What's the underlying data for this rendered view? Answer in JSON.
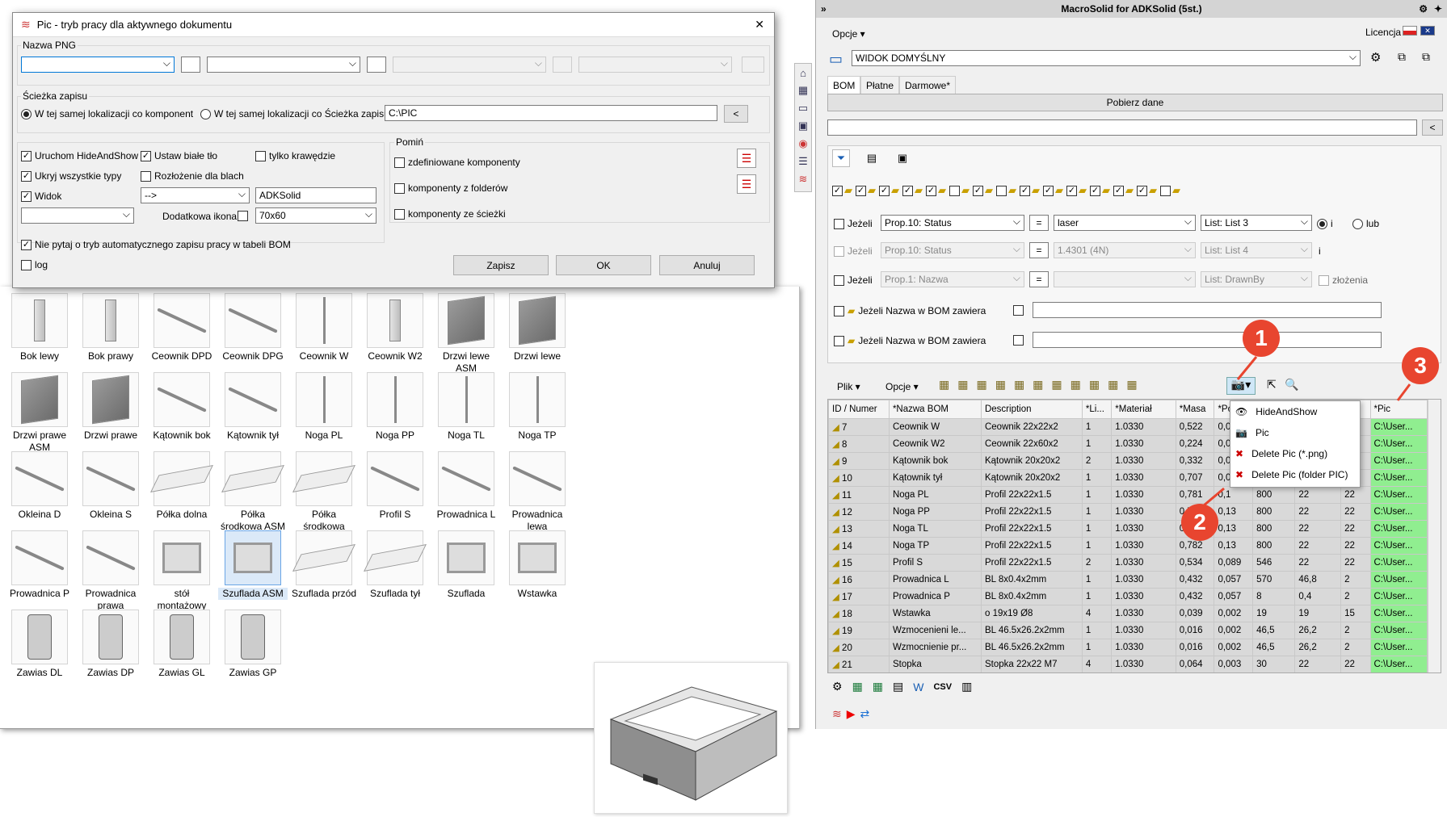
{
  "dialog": {
    "title": "Pic - tryb pracy dla aktywnego dokumentu",
    "close": "✕",
    "png_legend": "Nazwa PNG",
    "path_legend": "Ścieżka zapisu",
    "radio_component": "W tej samej lokalizacji co komponent",
    "radio_path": "W tej samej lokalizacji co Ścieżka zapisu",
    "path_value": "C:\\PIC",
    "path_btn": "<",
    "opt_hideandshow": "Uruchom HideAndShow",
    "opt_white_bg": "Ustaw białe tło",
    "opt_edges": "tylko krawędzie",
    "opt_hide_types": "Ukryj wszystkie typy",
    "opt_layout": "Rozłożenie dla blach",
    "opt_view": "Widok",
    "view_select": "-->",
    "view_name": "ADKSolid",
    "extra_icon_label": "Dodatkowa ikona",
    "extra_icon_size": "70x60",
    "skip_legend": "Pomiń",
    "skip_defined": "zdefiniowane komponenty",
    "skip_folders": "komponenty z folderów",
    "skip_paths": "komponenty ze ścieżki",
    "opt_noask": "Nie pytaj o tryb automatycznego zapisu pracy w tabeli BOM",
    "opt_log": "log",
    "btn_save": "Zapisz",
    "btn_ok": "OK",
    "btn_cancel": "Anuluj"
  },
  "explorer": {
    "items": [
      {
        "label": "Bok lewy",
        "icon": "panel"
      },
      {
        "label": "Bok prawy",
        "icon": "panel"
      },
      {
        "label": "Ceownik DPD",
        "icon": "rod"
      },
      {
        "label": "Ceownik DPG",
        "icon": "rod"
      },
      {
        "label": "Ceownik W",
        "icon": "vrod"
      },
      {
        "label": "Ceownik W2",
        "icon": "panel"
      },
      {
        "label": "Drzwi lewe ASM",
        "icon": "dark"
      },
      {
        "label": "Drzwi lewe",
        "icon": "dark"
      },
      {
        "label": "Drzwi prawe ASM",
        "icon": "dark"
      },
      {
        "label": "Drzwi prawe",
        "icon": "dark"
      },
      {
        "label": "Kątownik bok",
        "icon": "rod"
      },
      {
        "label": "Kątownik tył",
        "icon": "rod"
      },
      {
        "label": "Noga PL",
        "icon": "vrod"
      },
      {
        "label": "Noga PP",
        "icon": "vrod"
      },
      {
        "label": "Noga TL",
        "icon": "vrod"
      },
      {
        "label": "Noga TP",
        "icon": "vrod"
      },
      {
        "label": "Okleina D",
        "icon": "rod"
      },
      {
        "label": "Okleina S",
        "icon": "rod"
      },
      {
        "label": "Półka dolna",
        "icon": "plate"
      },
      {
        "label": "Półka środkowa ASM",
        "icon": "plate"
      },
      {
        "label": "Półka środkowa",
        "icon": "plate"
      },
      {
        "label": "Profil S",
        "icon": "rod"
      },
      {
        "label": "Prowadnica L",
        "icon": "rod"
      },
      {
        "label": "Prowadnica lewa",
        "icon": "rod"
      },
      {
        "label": "Prowadnica P",
        "icon": "rod"
      },
      {
        "label": "Prowadnica prawa",
        "icon": "rod"
      },
      {
        "label": "stół montażowy",
        "icon": "box"
      },
      {
        "label": "Szuflada ASM",
        "icon": "box",
        "selected": true
      },
      {
        "label": "Szuflada przód",
        "icon": "plate"
      },
      {
        "label": "Szuflada tył",
        "icon": "plate"
      },
      {
        "label": "Szuflada",
        "icon": "box"
      },
      {
        "label": "Wstawka",
        "icon": "box"
      },
      {
        "label": "Zawias DL",
        "icon": "hinge"
      },
      {
        "label": "Zawias DP",
        "icon": "hinge"
      },
      {
        "label": "Zawias GL",
        "icon": "hinge"
      },
      {
        "label": "Zawias GP",
        "icon": "hinge"
      }
    ]
  },
  "panel": {
    "title": "MacroSolid for ADKSolid (5st.)",
    "collapse": "»",
    "options_menu": "Opcje ▾",
    "license": "Licencja",
    "view_default": "WIDOK DOMYŚLNY",
    "tabs": [
      "BOM",
      "Płatne",
      "Darmowe*"
    ],
    "get_data": "Pobierz dane",
    "search_btn": "<",
    "cond1": {
      "label": "Jeżeli",
      "prop": "Prop.10: Status",
      "op": "=",
      "value": "laser",
      "list": "List: List 3",
      "and": "i",
      "or": "lub"
    },
    "cond2": {
      "label": "Jeżeli",
      "prop": "Prop.10: Status",
      "op": "=",
      "value": "1.4301 (4N)",
      "list": "List: List 4",
      "and": "i"
    },
    "cond3": {
      "label": "Jeżeli",
      "prop": "Prop.1: Nazwa",
      "op": "=",
      "value": "",
      "list": "List: DrawnBy",
      "assemblies": "złożenia"
    },
    "name_cond1": "Jeżeli Nazwa w BOM zawiera",
    "name_cond2": "Jeżeli Nazwa w BOM zawiera",
    "toolbar_file": "Plik ▾",
    "toolbar_options": "Opcje ▾"
  },
  "bom": {
    "columns": [
      "ID / Numer",
      "*Nazwa BOM",
      "Description",
      "*Li...",
      "*Materiał",
      "*Masa",
      "*Po...",
      "",
      "",
      "",
      "*Pic"
    ],
    "rows": [
      [
        "7",
        "Ceownik W",
        "Ceownik 22x22x2",
        "1",
        "1.0330",
        "0,522",
        "0,06",
        "",
        "",
        "",
        "C:\\User..."
      ],
      [
        "8",
        "Ceownik W2",
        "Ceownik 22x60x2",
        "1",
        "1.0330",
        "0,224",
        "0,02",
        "",
        "",
        "",
        "C:\\User..."
      ],
      [
        "9",
        "Kątownik bok",
        "Kątownik 20x20x2",
        "2",
        "1.0330",
        "0,332",
        "0,04",
        "",
        "",
        "",
        "C:\\User..."
      ],
      [
        "10",
        "Kątownik tył",
        "Kątownik 20x20x2",
        "1",
        "1.0330",
        "0,707",
        "0,09",
        "",
        "",
        "",
        "C:\\User..."
      ],
      [
        "11",
        "Noga PL",
        "Profil 22x22x1.5",
        "1",
        "1.0330",
        "0,781",
        "0,1",
        "800",
        "22",
        "22",
        "C:\\User..."
      ],
      [
        "12",
        "Noga PP",
        "Profil 22x22x1.5",
        "1",
        "1.0330",
        "0,78",
        "0,13",
        "800",
        "22",
        "22",
        "C:\\User..."
      ],
      [
        "13",
        "Noga TL",
        "Profil 22x22x1.5",
        "1",
        "1.0330",
        "0,78",
        "0,13",
        "800",
        "22",
        "22",
        "C:\\User..."
      ],
      [
        "14",
        "Noga TP",
        "Profil 22x22x1.5",
        "1",
        "1.0330",
        "0,782",
        "0,13",
        "800",
        "22",
        "22",
        "C:\\User..."
      ],
      [
        "15",
        "Profil S",
        "Profil 22x22x1.5",
        "2",
        "1.0330",
        "0,534",
        "0,089",
        "546",
        "22",
        "22",
        "C:\\User..."
      ],
      [
        "16",
        "Prowadnica L",
        "BL 8x0.4x2mm",
        "1",
        "1.0330",
        "0,432",
        "0,057",
        "570",
        "46,8",
        "2",
        "C:\\User..."
      ],
      [
        "17",
        "Prowadnica P",
        "BL 8x0.4x2mm",
        "1",
        "1.0330",
        "0,432",
        "0,057",
        "8",
        "0,4",
        "2",
        "C:\\User..."
      ],
      [
        "18",
        "Wstawka",
        "o 19x19 Ø8",
        "4",
        "1.0330",
        "0,039",
        "0,002",
        "19",
        "19",
        "15",
        "C:\\User..."
      ],
      [
        "19",
        "Wzmocenieni le...",
        "BL 46.5x26.2x2mm",
        "1",
        "1.0330",
        "0,016",
        "0,002",
        "46,5",
        "26,2",
        "2",
        "C:\\User..."
      ],
      [
        "20",
        "Wzmocnienie pr...",
        "BL 46.5x26.2x2mm",
        "1",
        "1.0330",
        "0,016",
        "0,002",
        "46,5",
        "26,2",
        "2",
        "C:\\User..."
      ],
      [
        "21",
        "Stopka",
        "Stopka 22x22 M7",
        "4",
        "1.0330",
        "0,064",
        "0,003",
        "30",
        "22",
        "22",
        "C:\\User..."
      ]
    ]
  },
  "context_menu": {
    "items": [
      "HideAndShow",
      "Pic",
      "Delete Pic (*.png)",
      "Delete Pic (folder PIC)"
    ]
  },
  "badges": [
    "1",
    "2",
    "3"
  ],
  "bottom_toolbar": {
    "csv": "CSV"
  },
  "colors": {
    "badge": "#e8452f",
    "pic_cell": "#90ee90",
    "row_bg": "#d9d9d9"
  }
}
